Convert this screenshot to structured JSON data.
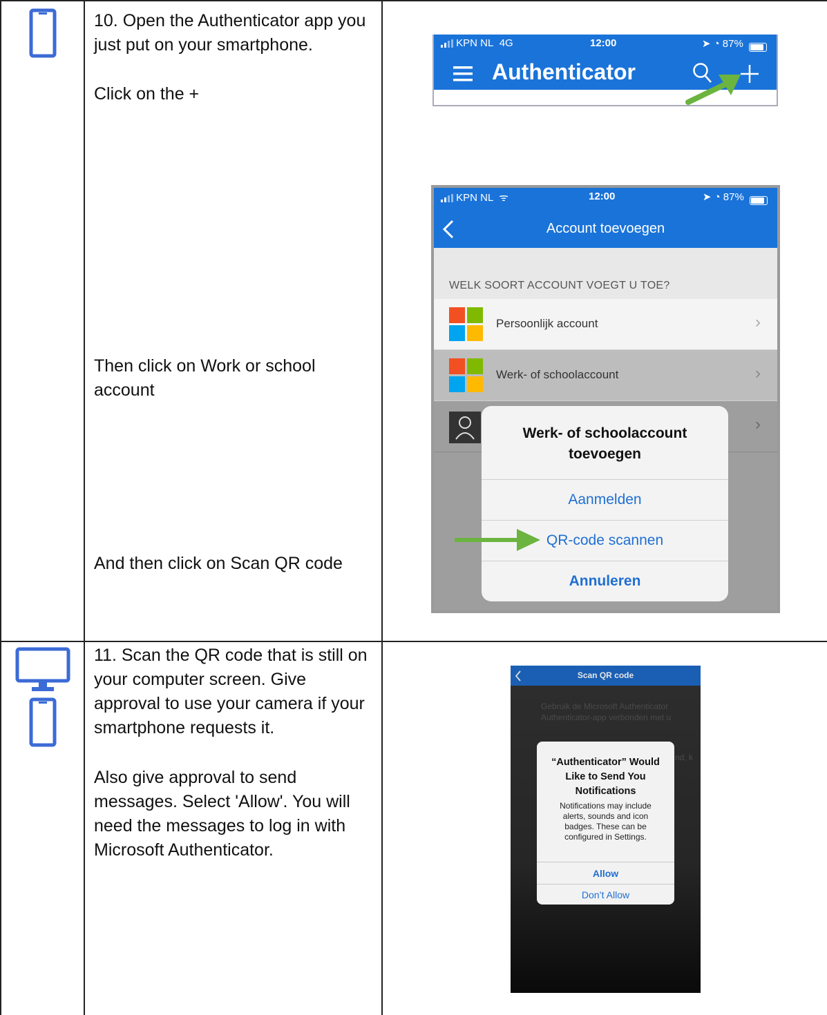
{
  "colors": {
    "accent": "#1a73d9",
    "icon_blue": "#3b6bd6",
    "arrow_green": "#6bb43f"
  },
  "steps": [
    {
      "icon": "smartphone-icon",
      "paragraphs": [
        "10. Open the Authenticator app you just put on your smartphone.",
        "Click on the +",
        "Then click on Work or school account",
        "And then click on Scan QR code"
      ]
    },
    {
      "icons": [
        "monitor-icon",
        "smartphone-icon"
      ],
      "paragraphs": [
        "11. Scan the QR code that is still on your computer screen. Give approval to use your camera if your smartphone requests it.",
        "Also give approval to send messages. Select 'Allow'. You will need the messages to log in with Microsoft Authenticator."
      ]
    }
  ],
  "shot1": {
    "carrier": "KPN NL",
    "network": "4G",
    "time": "12:00",
    "battery": "87%",
    "title": "Authenticator"
  },
  "shot2": {
    "carrier": "KPN NL",
    "time": "12:00",
    "battery": "87%",
    "title": "Account toevoegen",
    "section": "WELK SOORT ACCOUNT VOEGT U TOE?",
    "rows": [
      "Persoonlijk account",
      "Werk- of schoolaccount"
    ],
    "sheet_title": "Werk- of schoolaccount toevoegen",
    "sheet_actions": [
      "Aanmelden",
      "QR-code scannen",
      "Annuleren"
    ]
  },
  "shot3": {
    "title": "Scan QR code",
    "bg_text_1": "Gebruik de Microsoft Authenticator",
    "bg_text_2": "Authenticator-app verbonden met u",
    "bg_text_3": "nd, k",
    "alert_title": "“Authenticator” Would Like to Send You Notifications",
    "alert_body": "Notifications may include alerts, sounds and icon badges. These can be configured in Settings.",
    "allow": "Allow",
    "dont_allow": "Don’t Allow"
  }
}
